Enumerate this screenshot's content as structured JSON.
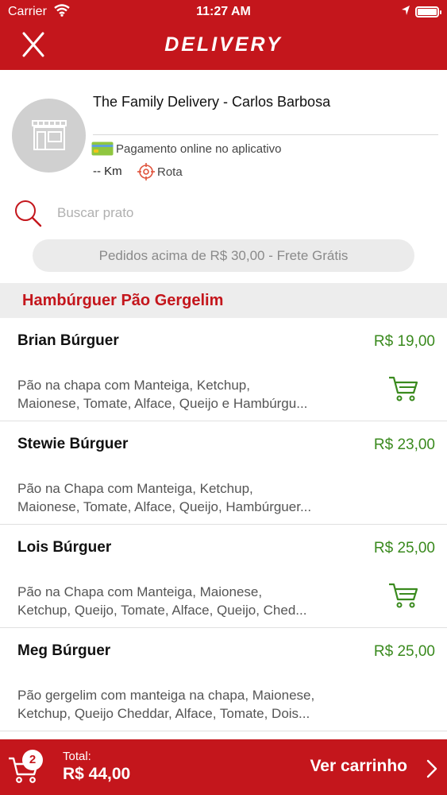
{
  "status_bar": {
    "carrier": "Carrier",
    "time": "11:27 AM"
  },
  "nav": {
    "title": "DELIVERY",
    "close_icon": "close-x-icon"
  },
  "store": {
    "name": "The Family Delivery - Carlos Barbosa",
    "payment_text": "Pagamento online no aplicativo",
    "distance": "-- Km",
    "route_label": "Rota"
  },
  "search": {
    "placeholder": "Buscar prato",
    "value": ""
  },
  "promo": "Pedidos acima de R$ 30,00 - Frete Grátis",
  "category": "Hambúrguer Pão Gergelim",
  "items": [
    {
      "name": "Brian Búrguer",
      "price": "R$ 19,00",
      "desc_line1": "Pão na chapa com Manteiga, Ketchup,",
      "desc_line2": "Maionese, Tomate, Alface, Queijo e Hambúrgu...",
      "in_cart": true
    },
    {
      "name": "Stewie Búrguer",
      "price": "R$ 23,00",
      "desc_line1": "Pão na Chapa com Manteiga, Ketchup,",
      "desc_line2": "Maionese, Tomate, Alface, Queijo, Hambúrguer...",
      "in_cart": false
    },
    {
      "name": "Lois Búrguer",
      "price": "R$ 25,00",
      "desc_line1": "Pão na Chapa com Manteiga, Maionese,",
      "desc_line2": "Ketchup, Queijo, Tomate, Alface, Queijo, Ched...",
      "in_cart": true
    },
    {
      "name": "Meg Búrguer",
      "price": "R$ 25,00",
      "desc_line1": "Pão gergelim com manteiga na chapa, Maionese,",
      "desc_line2": "Ketchup, Queijo Cheddar, Alface, Tomate, Dois...",
      "in_cart": false
    }
  ],
  "cart_bar": {
    "count": "2",
    "total_label": "Total:",
    "total_value": "R$ 44,00",
    "view_cart_label": "Ver carrinho"
  },
  "colors": {
    "brand_red": "#c4161c",
    "price_green": "#3a8a1e",
    "category_bg": "#ededed"
  }
}
